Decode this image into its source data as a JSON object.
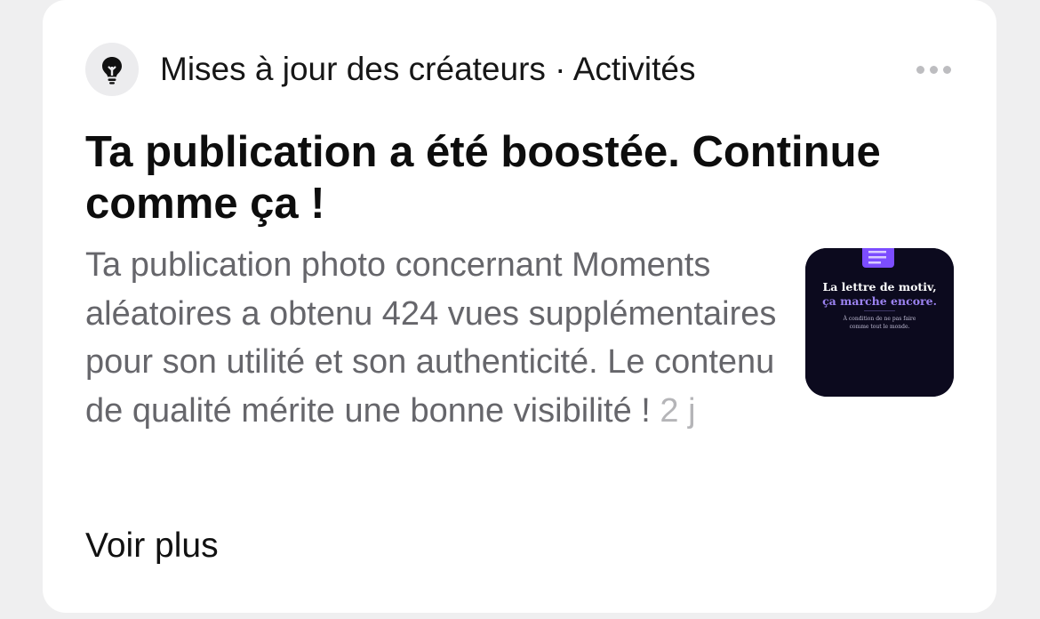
{
  "header": {
    "source": "Mises à jour des créateurs · Activités",
    "icon": "lightbulb-icon",
    "more_icon": "more-horizontal-icon"
  },
  "notification": {
    "title": "Ta publication a été boostée. Continue comme ça !",
    "body": "Ta publication photo concernant Moments aléatoires a obtenu 424 vues supplémentaires pour son utilité et son authenticité. Le contenu de qualité mérite une bonne visibilité ! ",
    "time": "2 j"
  },
  "thumbnail": {
    "line1": "La lettre de motiv,",
    "line2": "ça marche encore.",
    "caption1": "À condition de ne pas faire",
    "caption2": "comme tout le monde.",
    "background_color": "#0c0a1e",
    "accent_color": "#9b82f0"
  },
  "actions": {
    "see_more": "Voir plus"
  },
  "colors": {
    "page_bg": "#efeff0",
    "card_bg": "#ffffff",
    "title": "#0d0d0d",
    "body": "#66666b",
    "meta": "#b5b5b8"
  }
}
